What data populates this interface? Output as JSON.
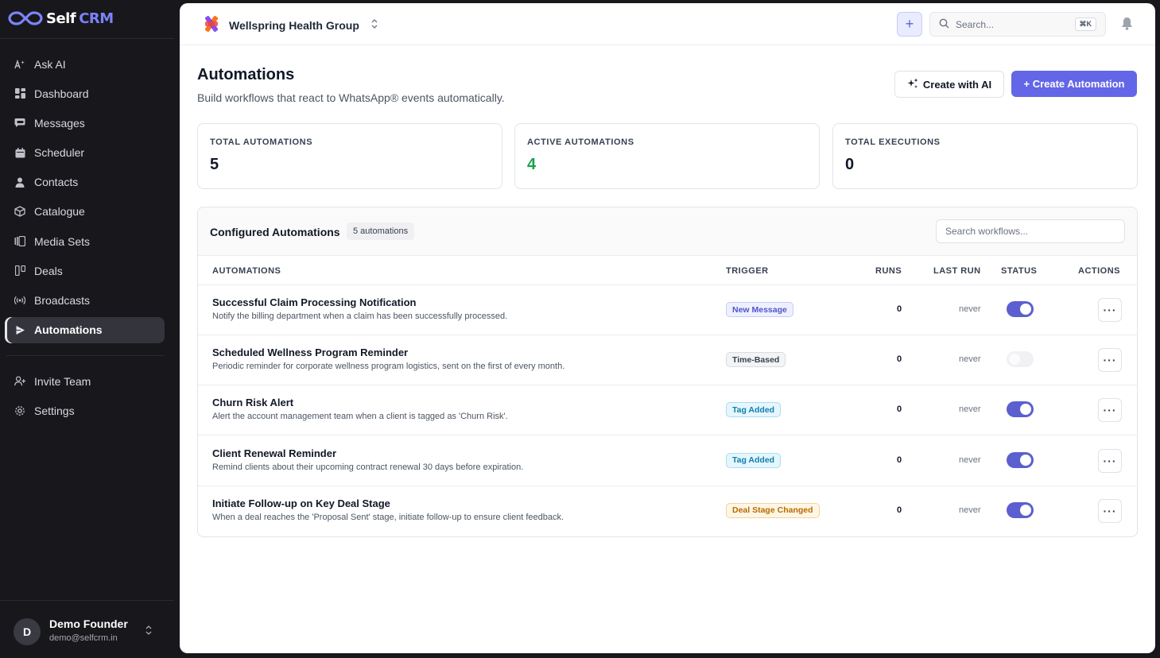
{
  "brand": {
    "self": "Self",
    "crm": "CRM"
  },
  "sidebar": {
    "items": [
      {
        "label": "Ask AI",
        "icon": "sparkle-text-icon"
      },
      {
        "label": "Dashboard",
        "icon": "dashboard-icon"
      },
      {
        "label": "Messages",
        "icon": "message-icon"
      },
      {
        "label": "Scheduler",
        "icon": "calendar-icon"
      },
      {
        "label": "Contacts",
        "icon": "person-icon"
      },
      {
        "label": "Catalogue",
        "icon": "box-icon"
      },
      {
        "label": "Media Sets",
        "icon": "media-icon"
      },
      {
        "label": "Deals",
        "icon": "kanban-icon"
      },
      {
        "label": "Broadcasts",
        "icon": "broadcast-icon"
      },
      {
        "label": "Automations",
        "icon": "play-icon",
        "active": true
      }
    ],
    "bottom_items": [
      {
        "label": "Invite Team",
        "icon": "user-plus-icon"
      },
      {
        "label": "Settings",
        "icon": "gear-icon"
      }
    ],
    "user": {
      "initial": "D",
      "name": "Demo Founder",
      "email": "demo@selfcrm.in"
    }
  },
  "topbar": {
    "org_name": "Wellspring Health Group",
    "search_placeholder": "Search...",
    "search_shortcut": "⌘K"
  },
  "page": {
    "title": "Automations",
    "subtitle": "Build workflows that react to WhatsApp® events automatically.",
    "create_ai_label": "Create with AI",
    "create_label": "+ Create Automation"
  },
  "stats": [
    {
      "label": "TOTAL AUTOMATIONS",
      "value": "5"
    },
    {
      "label": "ACTIVE AUTOMATIONS",
      "value": "4",
      "color": "#16a34a"
    },
    {
      "label": "TOTAL EXECUTIONS",
      "value": "0"
    }
  ],
  "table": {
    "title": "Configured Automations",
    "count_label": "5 automations",
    "search_placeholder": "Search workflows...",
    "headers": {
      "name": "AUTOMATIONS",
      "trigger": "TRIGGER",
      "runs": "RUNS",
      "last_run": "LAST RUN",
      "status": "STATUS",
      "actions": "ACTIONS"
    },
    "rows": [
      {
        "name": "Successful Claim Processing Notification",
        "desc": "Notify the billing department when a claim has been successfully processed.",
        "trigger": "New Message",
        "trigger_style": "indigo",
        "runs": "0",
        "last_run": "never",
        "enabled": true
      },
      {
        "name": "Scheduled Wellness Program Reminder",
        "desc": "Periodic reminder for corporate wellness program logistics, sent on the first of every month.",
        "trigger": "Time-Based",
        "trigger_style": "gray",
        "runs": "0",
        "last_run": "never",
        "enabled": false
      },
      {
        "name": "Churn Risk Alert",
        "desc": "Alert the account management team when a client is tagged as 'Churn Risk'.",
        "trigger": "Tag Added",
        "trigger_style": "sky",
        "runs": "0",
        "last_run": "never",
        "enabled": true
      },
      {
        "name": "Client Renewal Reminder",
        "desc": "Remind clients about their upcoming contract renewal 30 days before expiration.",
        "trigger": "Tag Added",
        "trigger_style": "sky",
        "runs": "0",
        "last_run": "never",
        "enabled": true
      },
      {
        "name": "Initiate Follow-up on Key Deal Stage",
        "desc": "When a deal reaches the 'Proposal Sent' stage, initiate follow-up to ensure client feedback.",
        "trigger": "Deal Stage Changed",
        "trigger_style": "amber",
        "runs": "0",
        "last_run": "never",
        "enabled": true
      }
    ],
    "action_glyph": "···"
  },
  "colors": {
    "accent": "#6366e6",
    "toggle_on": "#5b5fcf",
    "success": "#16a34a"
  }
}
